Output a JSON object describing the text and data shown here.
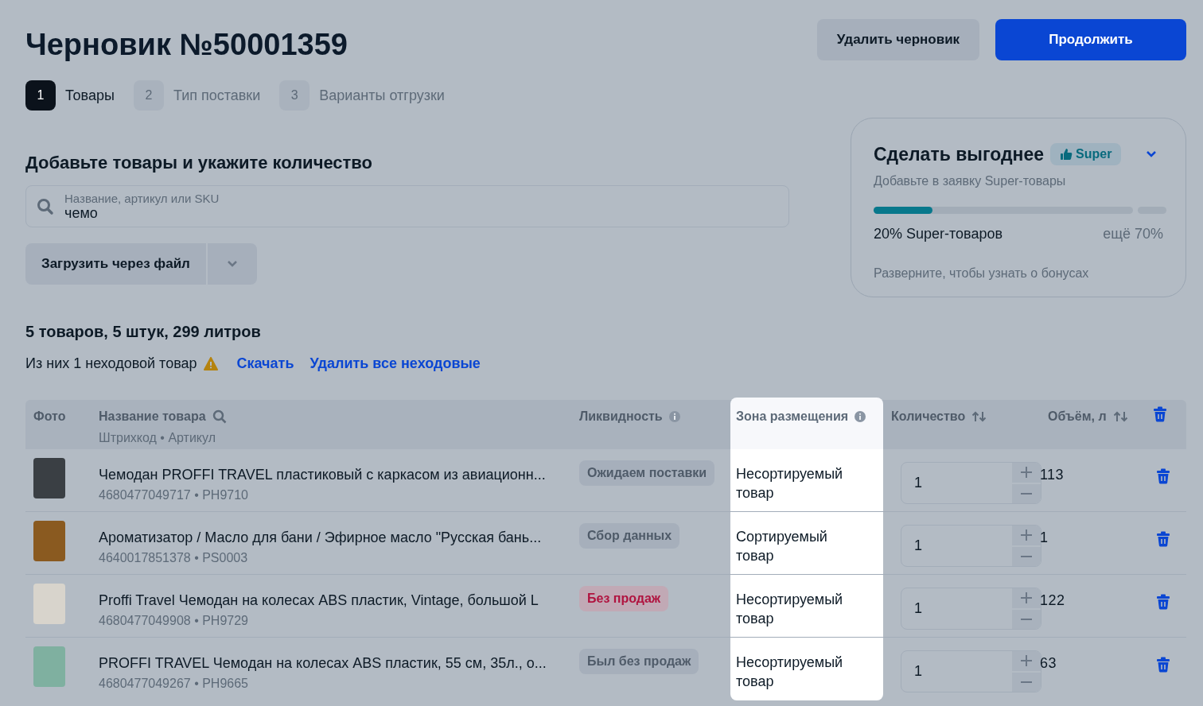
{
  "title": "Черновик №50001359",
  "header_buttons": [
    {
      "label": "Удалить черновик",
      "kind": "secondary"
    },
    {
      "label": "Продолжить",
      "kind": "primary"
    }
  ],
  "steps": [
    {
      "number": "1",
      "label": "Товары",
      "selected": true
    },
    {
      "number": "2",
      "label": "Тип поставки",
      "selected": false
    },
    {
      "number": "3",
      "label": "Варианты отгрузки",
      "selected": false
    }
  ],
  "section_title": "Добавьте товары и укажите количество",
  "search": {
    "placeholder": "Название, артикул или SKU",
    "value": "чемо"
  },
  "upload_button": "Загрузить через файл",
  "summary": "5 товаров, 5 штук, 299 литров",
  "notice": {
    "text": "Из них 1 неходовой товар",
    "links": [
      "Скачать",
      "Удалить все неходовые"
    ]
  },
  "promo": {
    "title": "Сделать выгоднее",
    "badge": "Super",
    "subtitle": "Добавьте в заявку Super-товары",
    "level": 0.2,
    "progress_label": "20% Super-товаров",
    "remaining": "ещё 70%",
    "hint": "Разверните, чтобы узнать о бонусах"
  },
  "table": {
    "columns": [
      {
        "label": "Фото",
        "kind": "plain"
      },
      {
        "label": "Название товара",
        "sublabel": "Штрихкод • Артикул",
        "kind": "search"
      },
      {
        "label": "Ликвидность",
        "kind": "info"
      },
      {
        "label": "Зона размещения",
        "kind": "info",
        "highlighted": true
      },
      {
        "label": "Количество",
        "kind": "sort"
      },
      {
        "label": "Объём, л",
        "kind": "sort"
      }
    ],
    "rows": [
      {
        "name": "Чемодан PROFFI TRAVEL пластиковый с каркасом из авиационн...",
        "codes": "4680477049717 • PH9710",
        "liquidity": {
          "label": "Ожидаем поставки",
          "kind": "neutral"
        },
        "zone": "Несортируемый товар",
        "quantity": "1",
        "volume": "113"
      },
      {
        "name": "Ароматизатор / Масло для бани / Эфирное масло \"Русская бань...",
        "codes": "4640017851378 • PS0003",
        "liquidity": {
          "label": "Сбор данных",
          "kind": "neutral"
        },
        "zone": "Сортируемый товар",
        "quantity": "1",
        "volume": "1"
      },
      {
        "name": "Proffi Travel Чемодан на колесах ABS пластик, Vintage, большой L",
        "codes": "4680477049908 • PH9729",
        "liquidity": {
          "label": "Без продаж",
          "kind": "danger"
        },
        "zone": "Несортируемый товар",
        "quantity": "1",
        "volume": "122"
      },
      {
        "name": "PROFFI TRAVEL Чемодан на колесах ABS пластик, 55 см, 35л., о...",
        "codes": "4680477049267 • PH9665",
        "liquidity": {
          "label": "Был без продаж",
          "kind": "neutral"
        },
        "zone": "Несортируемый товар",
        "quantity": "1",
        "volume": "63"
      }
    ]
  }
}
